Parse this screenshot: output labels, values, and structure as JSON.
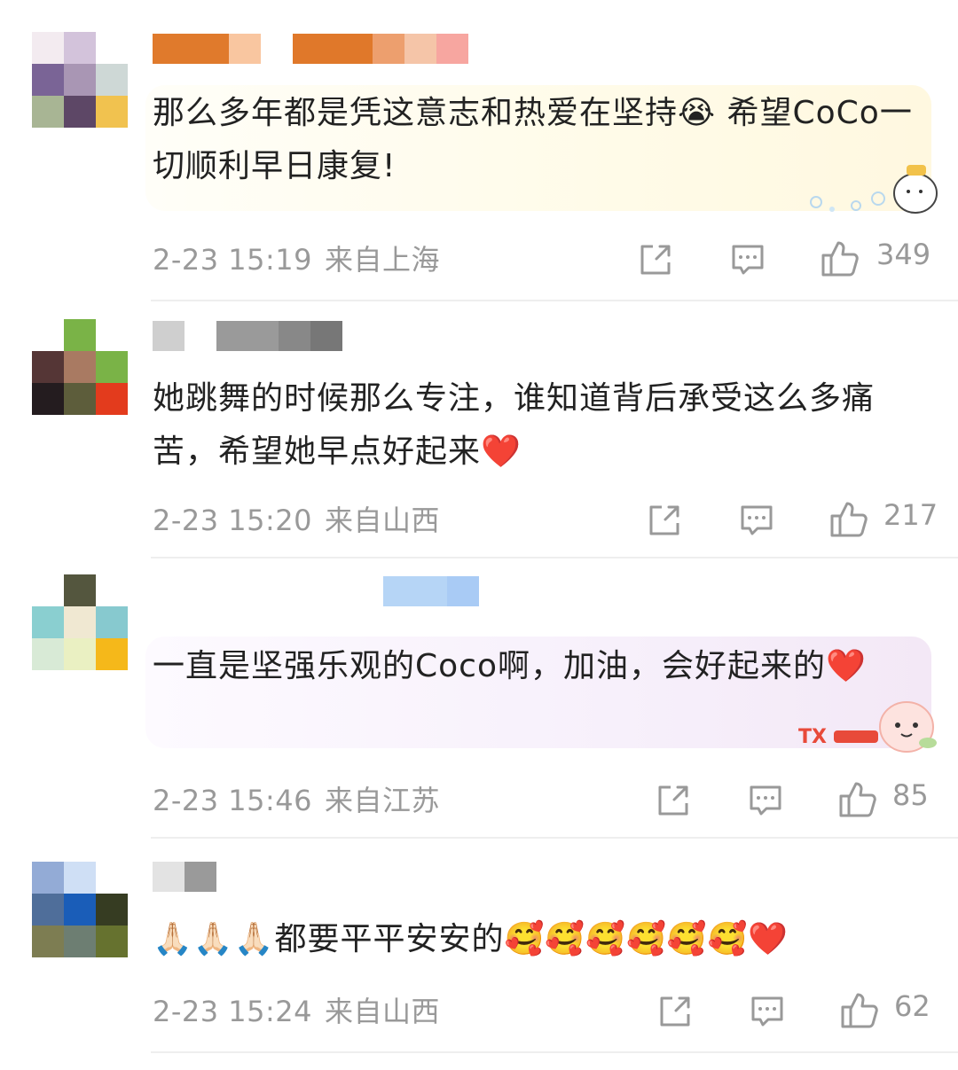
{
  "comments": [
    {
      "text": "那么多年都是凭这意志和热爱在坚持😭 希望CoCo一切顺利早日康复!",
      "time": "2-23 15:19",
      "location": "来自上海",
      "likes": "349",
      "bubble": "yellow",
      "avatar_colors": [
        "#f3ebf0",
        "#d3c3db",
        "#ffffff",
        "#7a6496",
        "#a996b4",
        "#ced8d6",
        "#a8b594",
        "#5d4766",
        "#f1c24f"
      ],
      "name_colors": [
        "#e07a2c",
        "#f9c6a0",
        "#e0782a",
        "#ed9f6e",
        "#f5c5a8",
        "#f7a6a0"
      ]
    },
    {
      "text": "她跳舞的时候那么专注，谁知道背后承受这么多痛苦，希望她早点好起来❤️",
      "time": "2-23 15:20",
      "location": "来自山西",
      "likes": "217",
      "bubble": "none",
      "avatar_colors": [
        "#ffffff",
        "#7ab347",
        "#ffffff",
        "#553636",
        "#a97a62",
        "#7ab347",
        "#241c1f",
        "#5d5d3b",
        "#e33b1d"
      ],
      "name_colors": [
        "#cfcfcf",
        "#9a9a9a",
        "#888888",
        "#777777"
      ]
    },
    {
      "text": "一直是坚强乐观的Coco啊，加油，会好起来的❤️",
      "time": "2-23 15:46",
      "location": "来自江苏",
      "likes": "85",
      "bubble": "pink",
      "avatar_colors": [
        "#ffffff",
        "#54563e",
        "#ffffff",
        "#8acfd0",
        "#f0e8d2",
        "#87c9cf",
        "#d8ead6",
        "#eaf0c2",
        "#f5b81a"
      ],
      "name_colors": [
        "#b6d5f6",
        "#a9cbf5"
      ]
    },
    {
      "text": "🙏🏻🙏🏻🙏🏻都要平平安安的🥰🥰🥰🥰🥰🥰❤️",
      "time": "2-23 15:24",
      "location": "来自山西",
      "likes": "62",
      "bubble": "none",
      "avatar_colors": [
        "#93abd6",
        "#cfdff5",
        "#ffffff",
        "#4f6e9a",
        "#1a5db8",
        "#363c22",
        "#7d7d52",
        "#6d7e72",
        "#66722f"
      ],
      "name_colors": [
        "#e3e3e3",
        "#9a9a9a"
      ]
    }
  ],
  "icons": {
    "share": "share-icon",
    "comment": "comment-icon",
    "like": "thumbs-up-icon"
  }
}
